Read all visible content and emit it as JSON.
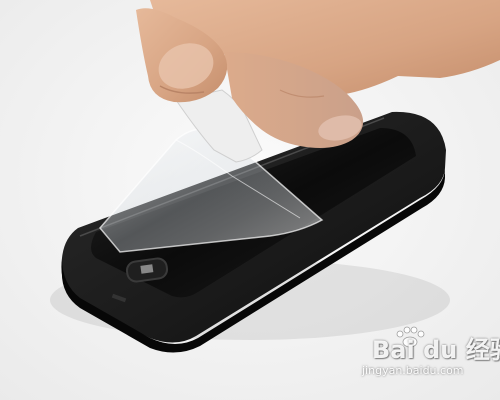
{
  "image": {
    "subject": "phone-with-protector-film",
    "colors": {
      "background": "#f4f4f4",
      "phone_body": "#1a1a1a",
      "screen": "#0c0c0c",
      "skin": "#d9a987",
      "film_tab": "#eeeeee"
    }
  },
  "watermark": {
    "brand": "Bai du 经验",
    "url": "jingyan.baidu.com",
    "icon": "paw-icon"
  }
}
